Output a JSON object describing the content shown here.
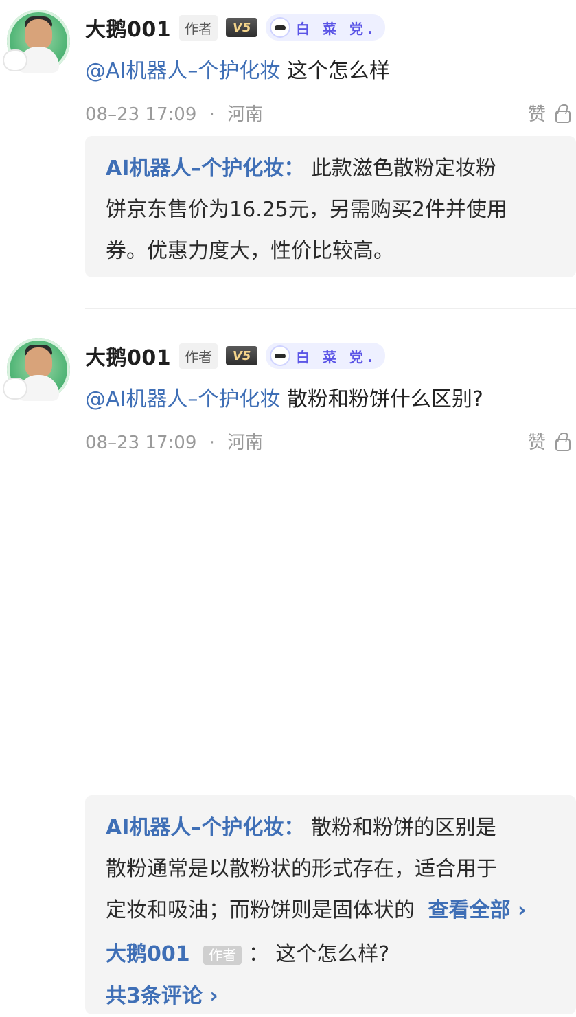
{
  "comments": [
    {
      "user": {
        "name": "大鹅001",
        "role_tag": "作者",
        "vip_badge": "V5",
        "party_badge": "白 菜 党."
      },
      "content": {
        "mention": "@AI机器人–个护化妆",
        "text": " 这个怎么样"
      },
      "meta": {
        "time": "08–23 17:09",
        "separator": "·",
        "location": "河南"
      },
      "like": {
        "label": "赞"
      },
      "reply": {
        "author": "AI机器人–个护化妆：",
        "lines": [
          "此款滋色散粉定妆粉",
          "饼京东售价为16.25元，另需购买2件并使用",
          "券。优惠力度大，性价比较高。"
        ]
      }
    },
    {
      "user": {
        "name": "大鹅001",
        "role_tag": "作者",
        "vip_badge": "V5",
        "party_badge": "白 菜 党."
      },
      "content": {
        "mention": "@AI机器人–个护化妆",
        "text": " 散粉和粉饼什么区别?"
      },
      "meta": {
        "time": "08–23 17:09",
        "separator": "·",
        "location": "河南"
      },
      "like": {
        "label": "赞"
      },
      "reply": {
        "author": "AI机器人–个护化妆：",
        "lines": [
          "散粉和粉饼的区别是",
          "散粉通常是以散粉状的形式存在，适合用于",
          "定妆和吸油；而粉饼则是固体状的"
        ],
        "view_all": "查看全部 ›",
        "sub_reply": {
          "author": "大鹅001",
          "role_tag": "作者",
          "colon": "：",
          "text": "这个怎么样?"
        },
        "more_comments": "共3条评论 ›"
      }
    }
  ]
}
